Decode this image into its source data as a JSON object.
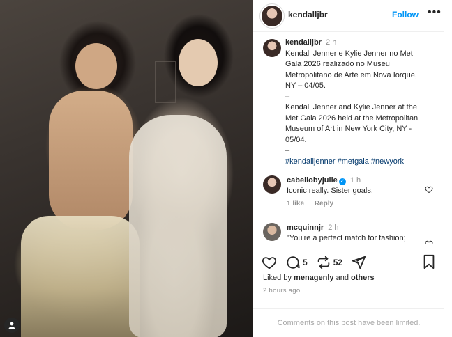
{
  "post": {
    "owner_username": "kendalljbr",
    "follow_label": "Follow",
    "more_label": "•••"
  },
  "caption": {
    "username": "kendalljbr",
    "time": "2 h",
    "lines": [
      "Kendall Jenner e Kylie Jenner no Met",
      "Gala 2026 realizado no Museu",
      "Metropolitano de Arte em Nova Iorque,",
      "NY – 04/05.",
      "–",
      "Kendall Jenner and Kylie Jenner at the",
      "Met Gala 2026 held at the Metropolitan",
      "Museum of Art in New York City, NY -",
      "05/04.",
      "–"
    ],
    "hashtags": "#kendalljenner #metgala #newyork"
  },
  "comments": [
    {
      "username": "cabellobyjulie",
      "verified": true,
      "time": "1 h",
      "text": "Iconic really. Sister goals.",
      "likes": "1 like",
      "reply_label": "Reply"
    },
    {
      "username": "mcquinnjr",
      "time": "2 h",
      "text": "\"You're a perfect match for fashion;"
    }
  ],
  "actions": {
    "comment_count": "5",
    "repost_count": "52",
    "liked_by_prefix": "Liked by",
    "liked_by_user": "menagenly",
    "liked_by_and": "and",
    "liked_by_others": "others",
    "time_ago": "2 hours ago"
  },
  "footer": {
    "comments_limited": "Comments on this post have been limited."
  },
  "icons": {
    "heart": "heart-icon",
    "comment": "comment-icon",
    "repost": "repost-icon",
    "share": "share-icon",
    "bookmark": "bookmark-icon",
    "user_tag": "user-tag-icon",
    "verified": "verified-badge-icon"
  },
  "colors": {
    "follow_blue": "#0095f6",
    "hashtag": "#00376b",
    "muted": "#8e8e8e",
    "text": "#262626"
  }
}
